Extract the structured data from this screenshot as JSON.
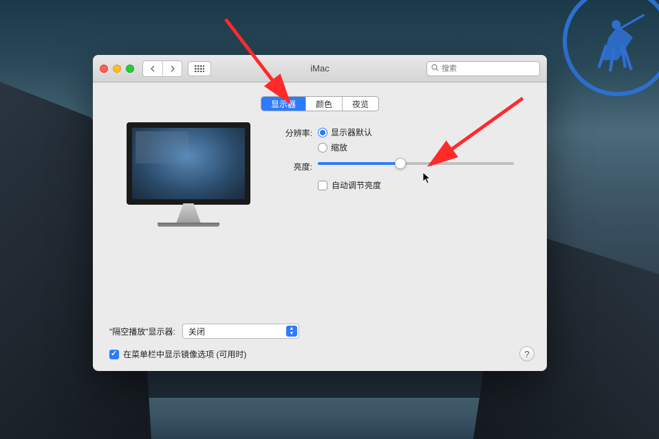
{
  "window": {
    "title": "iMac",
    "search_placeholder": "搜索"
  },
  "tabs": {
    "items": [
      {
        "label": "显示器",
        "active": true
      },
      {
        "label": "颜色",
        "active": false
      },
      {
        "label": "夜览",
        "active": false
      }
    ]
  },
  "resolution": {
    "label": "分辨率:",
    "options": [
      {
        "label": "显示器默认",
        "checked": true
      },
      {
        "label": "缩放",
        "checked": false
      }
    ]
  },
  "brightness": {
    "label": "亮度:",
    "slider_percent": 42,
    "auto_label": "自动调节亮度",
    "auto_checked": false
  },
  "airplay": {
    "label": "\"隔空播放\"显示器:",
    "value": "关闭"
  },
  "menubar": {
    "label": "在菜单栏中显示镜像选项 (可用时)",
    "checked": true
  },
  "help": "?"
}
